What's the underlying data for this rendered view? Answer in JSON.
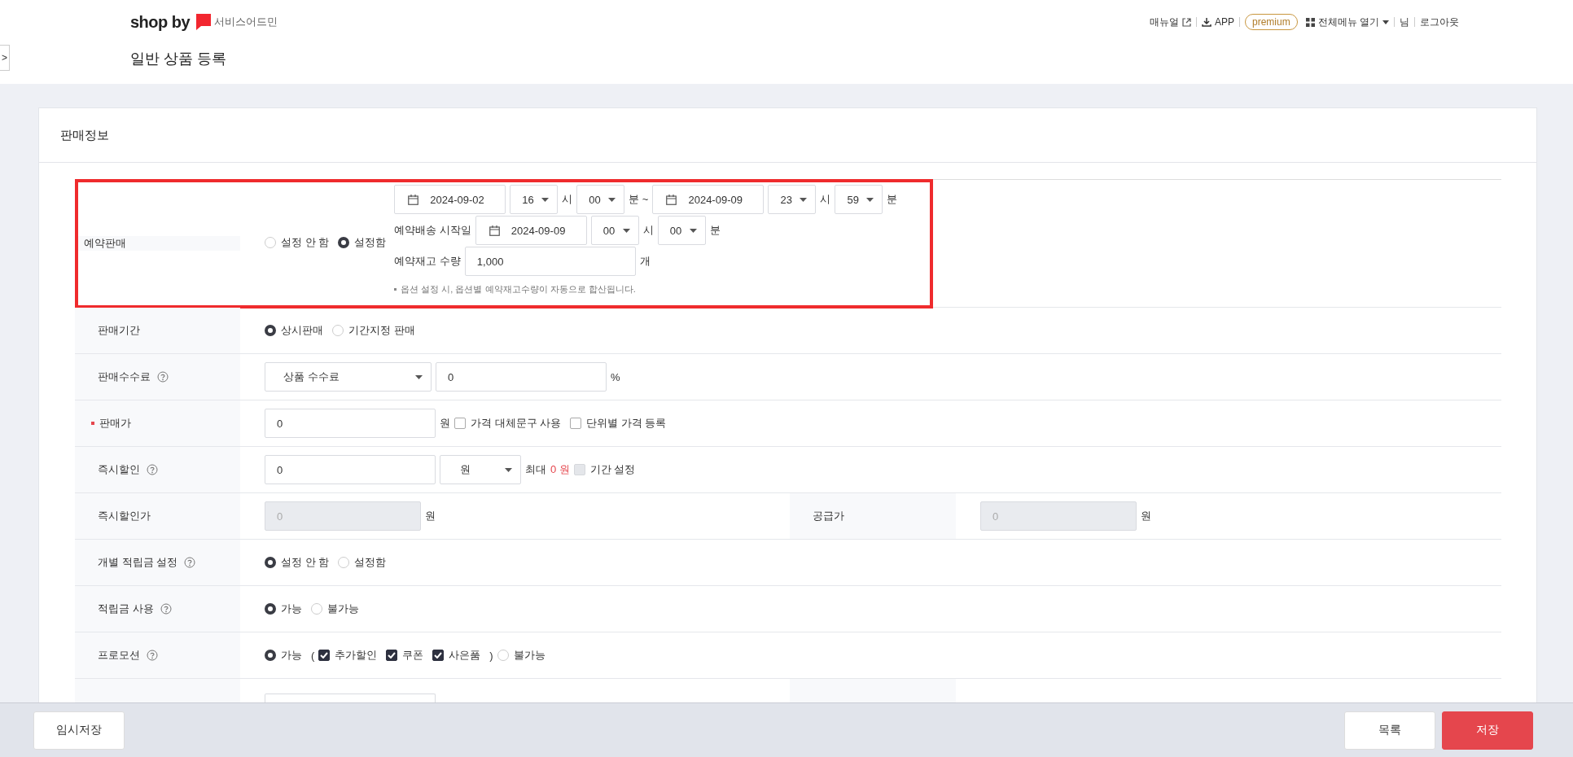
{
  "header": {
    "logo": "shop by",
    "logo_sub": "서비스어드민",
    "sidebar_toggle": ">",
    "page_title": "일반 상품 등록",
    "links": [
      {
        "kind": "external_link",
        "label": "매뉴얼"
      },
      {
        "kind": "download",
        "label": "APP"
      },
      {
        "kind": "badge",
        "label": "premium"
      },
      {
        "kind": "menu",
        "label": "전체메뉴 열기"
      },
      {
        "kind": "text",
        "label": "님"
      },
      {
        "kind": "link",
        "label": "로그아웃"
      }
    ]
  },
  "section": {
    "title": "판매정보",
    "rows": [
      {
        "highlighted": true,
        "cells": [
          {
            "label": "예약판매",
            "lead": [
              {
                "kind": "radio",
                "label": "설정 안 함",
                "selected": false
              },
              {
                "kind": "radio",
                "label": "설정함",
                "selected": true
              }
            ],
            "lines": [
              [
                {
                  "kind": "date",
                  "value": "2024-09-02"
                },
                {
                  "kind": "time_select",
                  "value": "16"
                },
                {
                  "kind": "text",
                  "value": "시"
                },
                {
                  "kind": "time_select",
                  "value": "00"
                },
                {
                  "kind": "text",
                  "value": "분 ~"
                },
                {
                  "kind": "date",
                  "value": "2024-09-09"
                },
                {
                  "kind": "time_select",
                  "value": "23"
                },
                {
                  "kind": "text",
                  "value": "시"
                },
                {
                  "kind": "time_select",
                  "value": "59"
                },
                {
                  "kind": "text",
                  "value": "분"
                }
              ],
              [
                {
                  "kind": "text",
                  "value": "예약배송 시작일"
                },
                {
                  "kind": "date",
                  "value": "2024-09-09"
                },
                {
                  "kind": "time_select",
                  "value": "00"
                },
                {
                  "kind": "text",
                  "value": "시"
                },
                {
                  "kind": "time_select",
                  "value": "00"
                },
                {
                  "kind": "text",
                  "value": "분"
                }
              ],
              [
                {
                  "kind": "text",
                  "value": "예약재고 수량"
                },
                {
                  "kind": "input",
                  "value": "1,000",
                  "disabled": false
                },
                {
                  "kind": "text",
                  "value": "개"
                }
              ]
            ],
            "note": "옵션 설정 시, 옵션별 예약재고수량이 자동으로 합산됩니다."
          }
        ]
      },
      {
        "cells": [
          {
            "label": "판매기간",
            "controls": [
              {
                "kind": "radio",
                "label": "상시판매",
                "selected": true
              },
              {
                "kind": "radio",
                "label": "기간지정 판매",
                "selected": false
              }
            ]
          }
        ]
      },
      {
        "cells": [
          {
            "label": "판매수수료",
            "help": true,
            "controls": [
              {
                "kind": "select",
                "value": "상품 수수료"
              },
              {
                "kind": "input",
                "value": "0",
                "disabled": false
              },
              {
                "kind": "text",
                "value": "%"
              }
            ]
          }
        ]
      },
      {
        "cells": [
          {
            "label": "판매가",
            "required": true,
            "controls": [
              {
                "kind": "input",
                "value": "0",
                "disabled": false
              },
              {
                "kind": "text",
                "value": "원"
              },
              {
                "kind": "checkbox",
                "label": "가격 대체문구 사용",
                "checked": false,
                "disabled": false
              },
              {
                "kind": "checkbox",
                "label": "단위별 가격 등록",
                "checked": false,
                "disabled": false
              }
            ]
          }
        ]
      },
      {
        "cells": [
          {
            "label": "즉시할인",
            "help": true,
            "controls": [
              {
                "kind": "input",
                "value": "0",
                "disabled": false
              },
              {
                "kind": "unit_select",
                "value": "원"
              },
              {
                "kind": "text",
                "value": "최대"
              },
              {
                "kind": "accent",
                "value": "0 원"
              },
              {
                "kind": "checkbox",
                "label": "기간 설정",
                "checked": false,
                "disabled": true
              }
            ]
          }
        ]
      },
      {
        "cells": [
          {
            "label": "즉시할인가",
            "controls": [
              {
                "kind": "input",
                "value": "0",
                "disabled": true
              },
              {
                "kind": "text",
                "value": "원"
              }
            ]
          },
          {
            "label": "공급가",
            "controls": [
              {
                "kind": "input",
                "value": "0",
                "disabled": true
              },
              {
                "kind": "text",
                "value": "원"
              }
            ]
          }
        ]
      },
      {
        "cells": [
          {
            "label": "개별 적립금 설정",
            "help": true,
            "controls": [
              {
                "kind": "radio",
                "label": "설정 안 함",
                "selected": true
              },
              {
                "kind": "radio",
                "label": "설정함",
                "selected": false
              }
            ]
          }
        ]
      },
      {
        "cells": [
          {
            "label": "적립금 사용",
            "help": true,
            "controls": [
              {
                "kind": "radio",
                "label": "가능",
                "selected": true
              },
              {
                "kind": "radio",
                "label": "불가능",
                "selected": false
              }
            ]
          }
        ]
      },
      {
        "cells": [
          {
            "label": "프로모션",
            "help": true,
            "controls": [
              {
                "kind": "radio",
                "label": "가능",
                "selected": true
              },
              {
                "kind": "text",
                "value": "("
              },
              {
                "kind": "checkbox",
                "label": "추가할인",
                "checked": true,
                "disabled": false
              },
              {
                "kind": "checkbox",
                "label": "쿠폰",
                "checked": true,
                "disabled": false
              },
              {
                "kind": "checkbox",
                "label": "사은품",
                "checked": true,
                "disabled": false
              },
              {
                "kind": "text",
                "value": ")"
              },
              {
                "kind": "radio",
                "label": "불가능",
                "selected": false
              }
            ]
          }
        ]
      },
      {
        "cells": [
          {
            "controls": [
              {
                "kind": "input",
                "disabled": false
              }
            ]
          },
          {}
        ]
      }
    ]
  },
  "footer": {
    "buttons": [
      {
        "kind": "secondary",
        "label": "임시저장"
      },
      {
        "kind": "secondary",
        "label": "목록"
      },
      {
        "kind": "primary",
        "label": "저장"
      }
    ]
  }
}
